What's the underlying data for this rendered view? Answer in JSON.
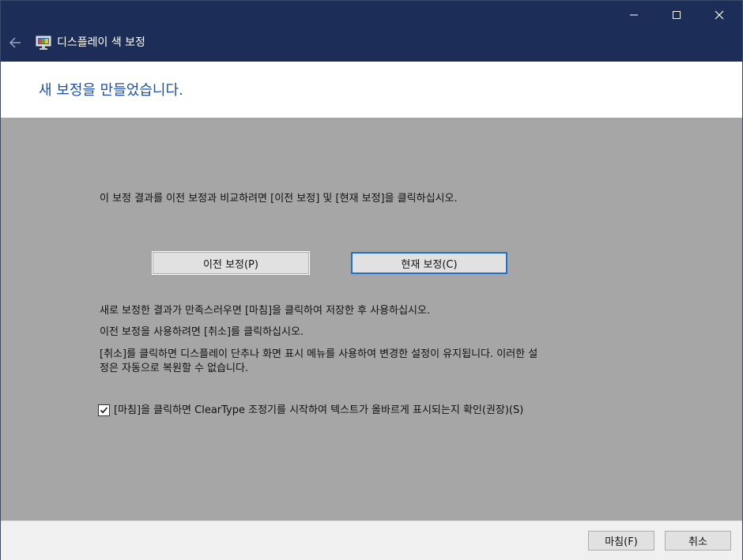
{
  "window": {
    "title": "디스플레이 색 보정",
    "minimize_label": "Minimize",
    "maximize_label": "Maximize",
    "close_label": "Close"
  },
  "header": {
    "title": "새 보정을 만들었습니다."
  },
  "content": {
    "intro": "이 보정 결과를 이전 보정과 비교하려면 [이전 보정] 및 [현재 보정]을 클릭하십시오.",
    "previous_button": "이전 보정(P)",
    "current_button": "현재 보정(C)",
    "finish_info": "새로 보정한 결과가 만족스러우면 [마침]을 클릭하여 저장한 후 사용하십시오.",
    "cancel_info": "이전 보정을 사용하려면 [취소]를 클릭하십시오.",
    "warning_line1": "[취소]를 클릭하면 디스플레이 단추나 화면 표시 메뉴를 사용하여 변경한 설정이 유지됩니다. 이러한 설",
    "warning_line2": "정은 자동으로 복원할 수 없습니다.",
    "cleartype_checkbox_label": "[마침]을 클릭하면 ClearType 조정기를 시작하여 텍스트가 올바르게 표시되는지 확인(권장)(S)",
    "cleartype_checked": true
  },
  "footer": {
    "finish_button": "마침(F)",
    "cancel_button": "취소"
  },
  "colors": {
    "titlebar": "#1c2d57",
    "header_title": "#1e4fa6",
    "content_bg": "#a6a6a6",
    "focus_border": "#1f6fcf"
  },
  "icons": {
    "back": "arrow-left-icon",
    "app": "display-color-monitor-icon",
    "minimize": "minimize-icon",
    "maximize": "maximize-icon",
    "close": "close-icon",
    "check": "checkmark-icon"
  }
}
